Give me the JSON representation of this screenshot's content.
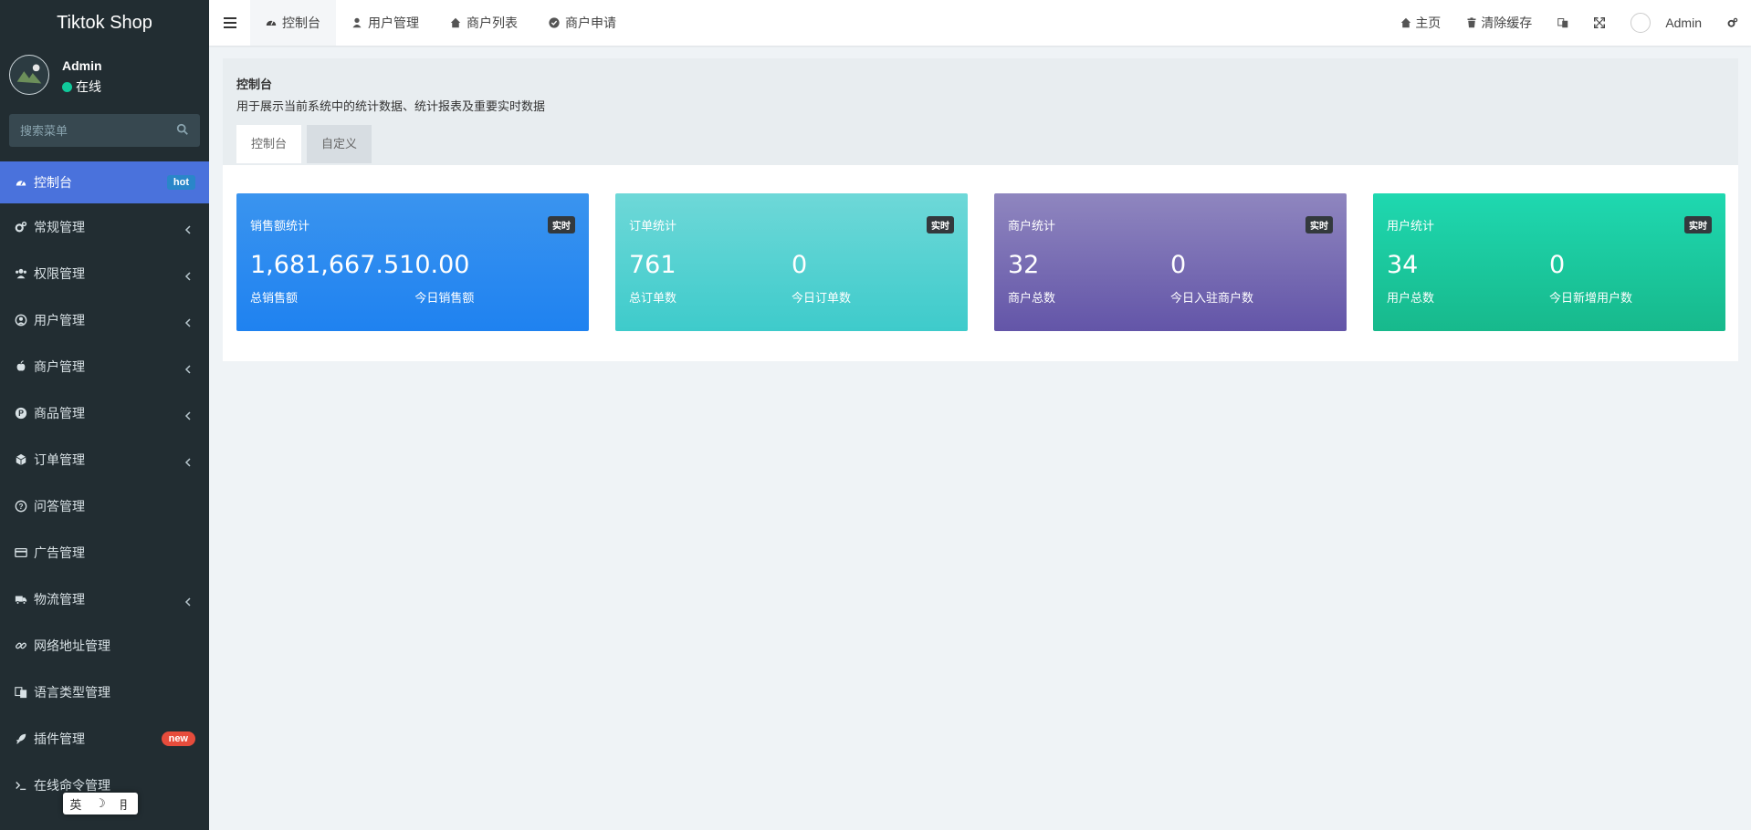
{
  "sidebar": {
    "brand": "Tiktok Shop",
    "user": {
      "name": "Admin",
      "status": "在线"
    },
    "search": {
      "placeholder": "搜索菜单"
    },
    "items": [
      {
        "label": "控制台",
        "icon": "dashboard-icon",
        "badge": "hot"
      },
      {
        "label": "常规管理",
        "icon": "cogs-icon"
      },
      {
        "label": "权限管理",
        "icon": "group-icon"
      },
      {
        "label": "用户管理",
        "icon": "user-circle-icon"
      },
      {
        "label": "商户管理",
        "icon": "apple-icon"
      },
      {
        "label": "商品管理",
        "icon": "product-p-icon"
      },
      {
        "label": "订单管理",
        "icon": "cube-icon"
      },
      {
        "label": "问答管理",
        "icon": "question-circle-icon"
      },
      {
        "label": "广告管理",
        "icon": "card-icon"
      },
      {
        "label": "物流管理",
        "icon": "truck-icon"
      },
      {
        "label": "网络地址管理",
        "icon": "link-icon"
      },
      {
        "label": "语言类型管理",
        "icon": "language-icon"
      },
      {
        "label": "插件管理",
        "icon": "rocket-icon",
        "badge": "new"
      },
      {
        "label": "在线命令管理",
        "icon": "terminal-icon"
      }
    ]
  },
  "ime": {
    "chars": [
      "英",
      "☽",
      "⺝"
    ]
  },
  "topbar": {
    "tabs": [
      {
        "label": "控制台",
        "icon": "dashboard-icon"
      },
      {
        "label": "用户管理",
        "icon": "user-icon"
      },
      {
        "label": "商户列表",
        "icon": "home-icon"
      },
      {
        "label": "商户申请",
        "icon": "check-circle-icon"
      }
    ],
    "right": {
      "home": "主页",
      "clear_cache": "清除缓存",
      "user": "Admin"
    }
  },
  "page": {
    "title": "控制台",
    "description": "用于展示当前系统中的统计数据、统计报表及重要实时数据",
    "tabs": [
      "控制台",
      "自定义"
    ]
  },
  "stats": [
    {
      "title": "销售额统计",
      "badge": "实时",
      "left_value": "1,681,667.51",
      "left_label": "总销售额",
      "right_value": "0.00",
      "right_label": "今日销售额"
    },
    {
      "title": "订单统计",
      "badge": "实时",
      "left_value": "761",
      "left_label": "总订单数",
      "right_value": "0",
      "right_label": "今日订单数"
    },
    {
      "title": "商户统计",
      "badge": "实时",
      "left_value": "32",
      "left_label": "商户总数",
      "right_value": "0",
      "right_label": "今日入驻商户数"
    },
    {
      "title": "用户统计",
      "badge": "实时",
      "left_value": "34",
      "left_label": "用户总数",
      "right_value": "0",
      "right_label": "今日新增用户数"
    }
  ]
}
